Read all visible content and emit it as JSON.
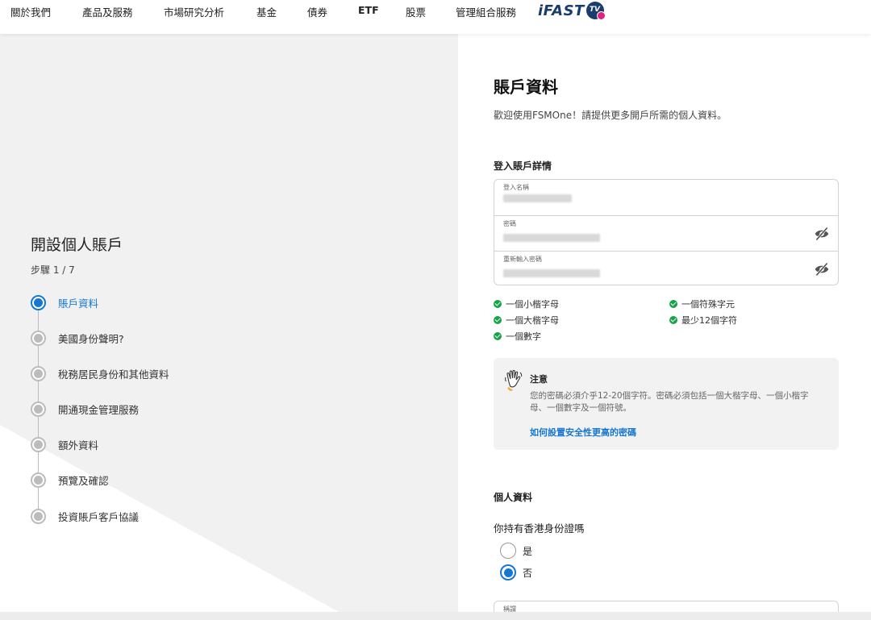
{
  "nav": {
    "items": [
      "關於我們",
      "產品及服務",
      "市場研究分析",
      "基金",
      "債券",
      "ETF",
      "股票",
      "管理組合服務"
    ],
    "logo_text": "iFAST",
    "logo_badge": "TV"
  },
  "left": {
    "title": "開設個人賬戶",
    "step": "步驟 1 / 7",
    "steps": [
      "賬戶資料",
      "美國身份聲明?",
      "稅務居民身份和其他資料",
      "開通現金管理服務",
      "額外資料",
      "預覽及確認",
      "投資賬戶客戶協議"
    ]
  },
  "right": {
    "title": "賬戶資料",
    "subtitle": "歡迎使用FSMOne！請提供更多開戶所需的個人資料。",
    "login_section": "登入賬戶詳情",
    "fields": {
      "username_label": "登入名稱",
      "password_label": "密碼",
      "confirm_label": "重新輸入密碼"
    },
    "rules": [
      "一個小楷字母",
      "一個符殊字元",
      "一個大楷字母",
      "最少12個字符",
      "一個數字"
    ],
    "note": {
      "title": "注意",
      "text": "您的密碼必須介乎12-20個字符。密碼必須包括一個大楷字母、一個小楷字母、一個數字及一個符號。",
      "link": "如何設置安全性更高的密碼"
    },
    "personal_section": "個人資料",
    "hkid_question": "你持有香港身份證嗎",
    "options": [
      "是",
      "否"
    ],
    "selected_option": "否",
    "bottom_field_label": "稱謂"
  },
  "colors": {
    "accent": "#1677d2",
    "check": "#17a34a",
    "logo": "#1a3d6e",
    "logo_dot": "#e0217d"
  }
}
